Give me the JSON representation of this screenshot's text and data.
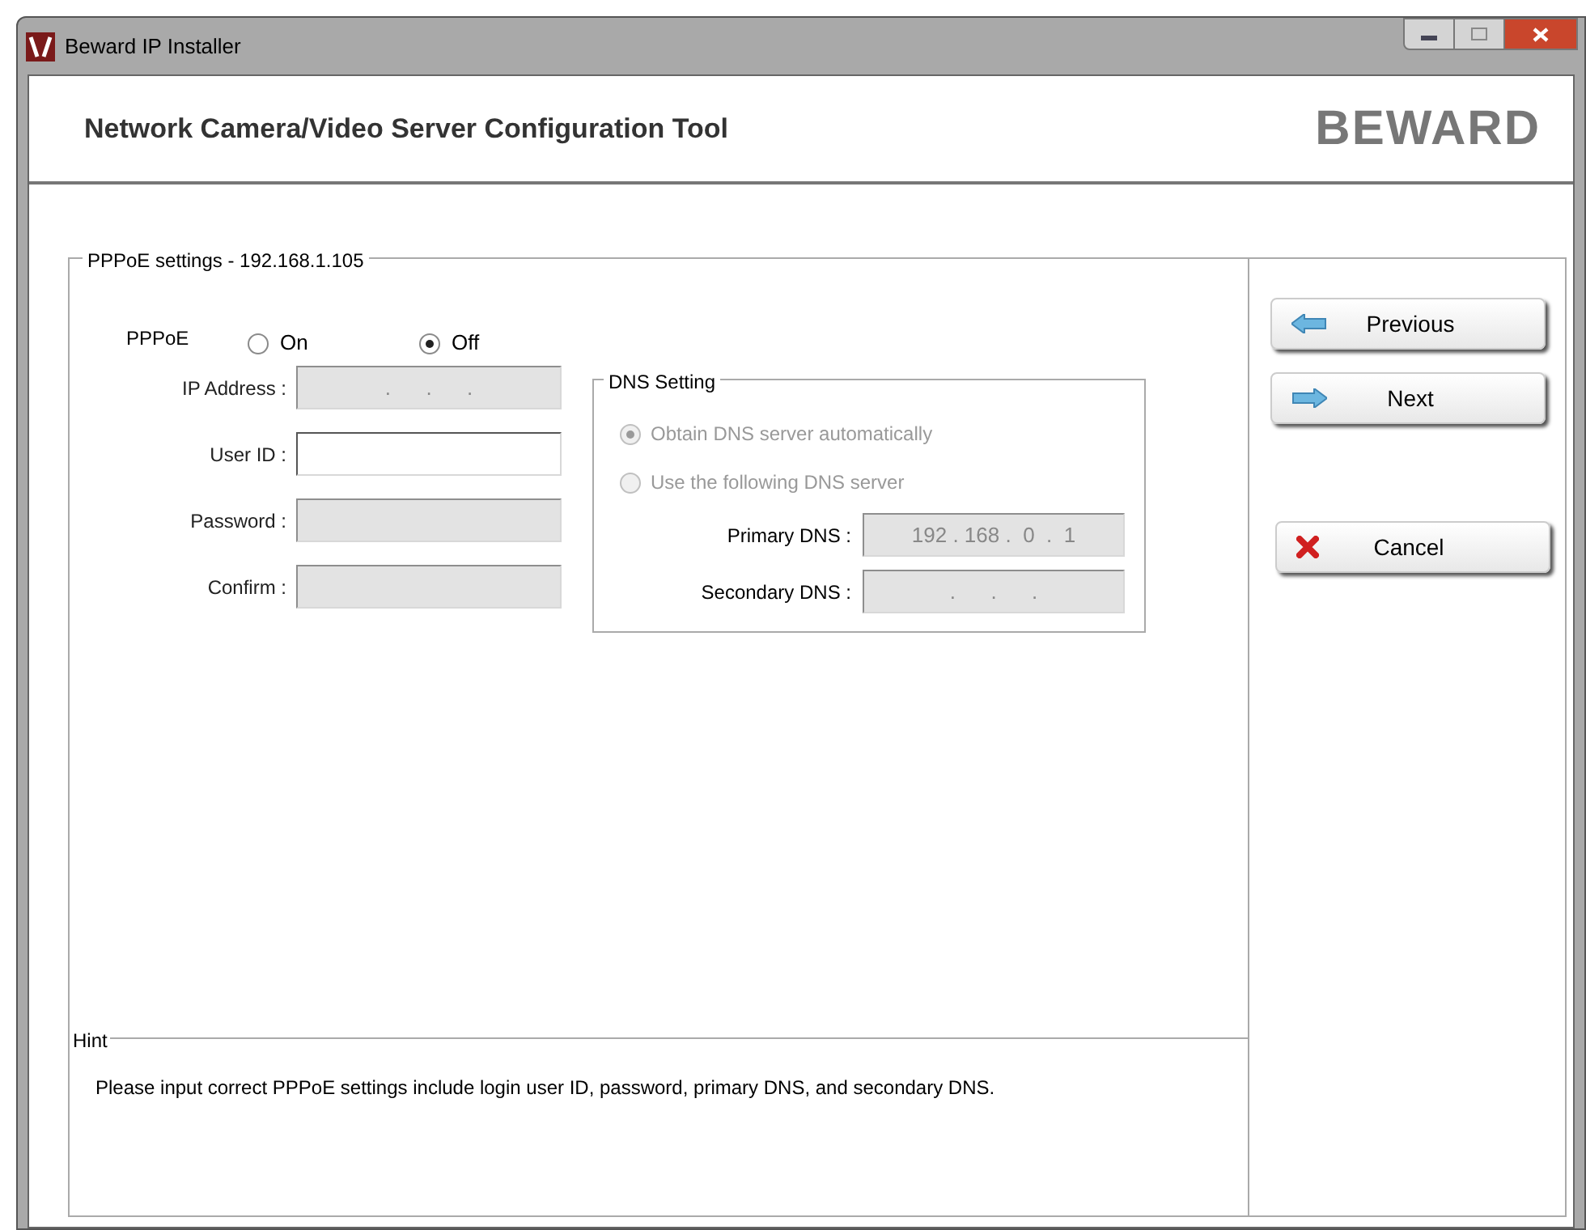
{
  "window": {
    "title": "Beward IP Installer"
  },
  "header": {
    "title": "Network Camera/Video Server Configuration Tool",
    "logo": "BEWARD"
  },
  "settings": {
    "legend": "PPPoE settings - 192.168.1.105",
    "pppoe": {
      "label": "PPPoE",
      "options": [
        {
          "label": "On",
          "selected": false
        },
        {
          "label": "Off",
          "selected": true
        }
      ]
    },
    "fields": [
      {
        "label": "IP Address :",
        "value": ".      .      .",
        "disabled": true
      },
      {
        "label": "User ID :",
        "disabled": false
      },
      {
        "label": "Password :",
        "disabled": true
      },
      {
        "label": "Confirm :",
        "disabled": true
      }
    ],
    "dns": {
      "legend": "DNS Setting",
      "options": [
        {
          "label": "Obtain DNS server automatically",
          "selected": true,
          "disabled": true
        },
        {
          "label": "Use the following DNS server",
          "selected": false,
          "disabled": true
        }
      ],
      "fields": [
        {
          "label": "Primary DNS :",
          "value": "192 . 168 .  0  .  1",
          "disabled": true
        },
        {
          "label": "Secondary DNS :",
          "value": ".      .      .",
          "disabled": true
        }
      ]
    }
  },
  "hint": {
    "legend": "Hint",
    "text": "Please input correct PPPoE settings include login user ID, password, primary DNS, and secondary DNS."
  },
  "buttons": [
    {
      "label": "Previous",
      "kind": "back"
    },
    {
      "label": "Next",
      "kind": "forward"
    },
    {
      "label": "Cancel",
      "kind": "cancel"
    }
  ]
}
